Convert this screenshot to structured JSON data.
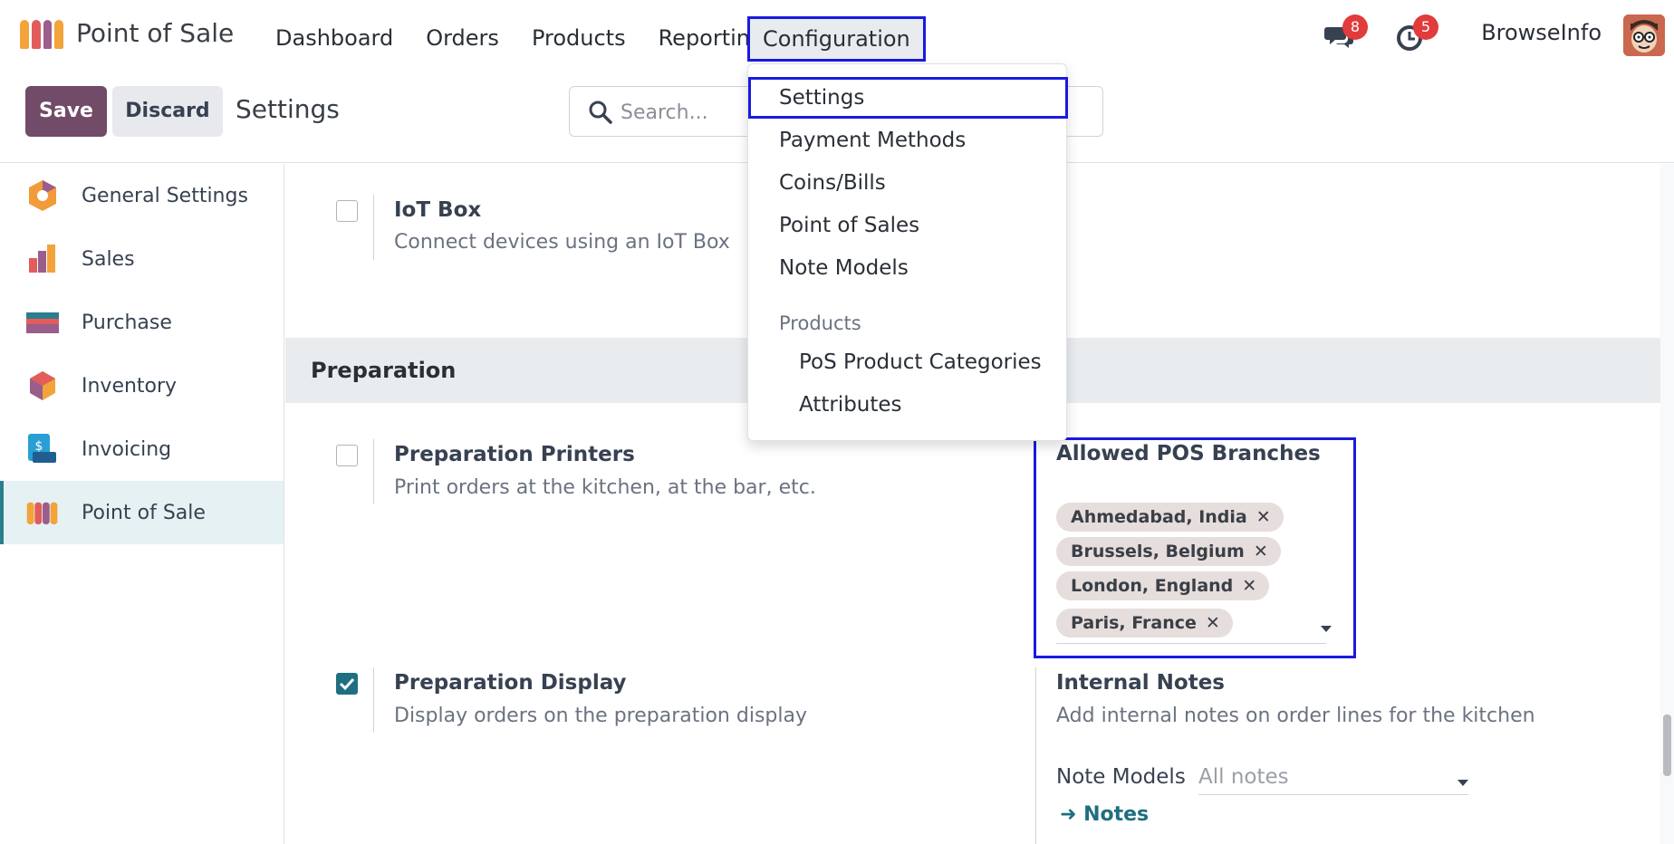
{
  "app": {
    "title": "Point of Sale"
  },
  "nav": {
    "items": [
      "Dashboard",
      "Orders",
      "Products",
      "Reporting"
    ],
    "active": "Configuration"
  },
  "header": {
    "messages_count": "8",
    "activity_count": "5",
    "user": "BrowseInfo"
  },
  "toolbar": {
    "save_label": "Save",
    "discard_label": "Discard",
    "breadcrumb": "Settings",
    "search_placeholder": "Search..."
  },
  "sidebar": {
    "items": [
      {
        "label": "General Settings",
        "icon": "general-settings-icon"
      },
      {
        "label": "Sales",
        "icon": "sales-icon"
      },
      {
        "label": "Purchase",
        "icon": "purchase-icon"
      },
      {
        "label": "Inventory",
        "icon": "inventory-icon"
      },
      {
        "label": "Invoicing",
        "icon": "invoicing-icon"
      },
      {
        "label": "Point of Sale",
        "icon": "point-of-sale-icon",
        "active": true
      }
    ]
  },
  "content": {
    "iot": {
      "title": "IoT Box",
      "desc": "Connect devices using an IoT Box"
    },
    "section_title": "Preparation",
    "printers": {
      "title": "Preparation Printers",
      "desc": "Print orders at the kitchen, at the bar, etc."
    },
    "branches": {
      "title": "Allowed POS Branches",
      "tags": [
        "Ahmedabad, India",
        "Brussels, Belgium",
        "London, England",
        "Paris, France"
      ]
    },
    "display": {
      "title": "Preparation Display",
      "desc": "Display orders on the preparation display",
      "checked": true
    },
    "internal_notes": {
      "title": "Internal Notes",
      "desc": "Add internal notes on order lines for the kitchen",
      "note_models_label": "Note Models",
      "note_models_value": "All notes",
      "notes_link": "Notes"
    }
  },
  "dropdown": {
    "items": [
      "Settings",
      "Payment Methods",
      "Coins/Bills",
      "Point of Sales",
      "Note Models"
    ],
    "products_header": "Products",
    "product_items": [
      "PoS Product Categories",
      "Attributes"
    ]
  },
  "colors": {
    "accent": "#714b67",
    "teal": "#1f6f80",
    "highlight": "#1a1ae0",
    "badge": "#e23b3b"
  }
}
